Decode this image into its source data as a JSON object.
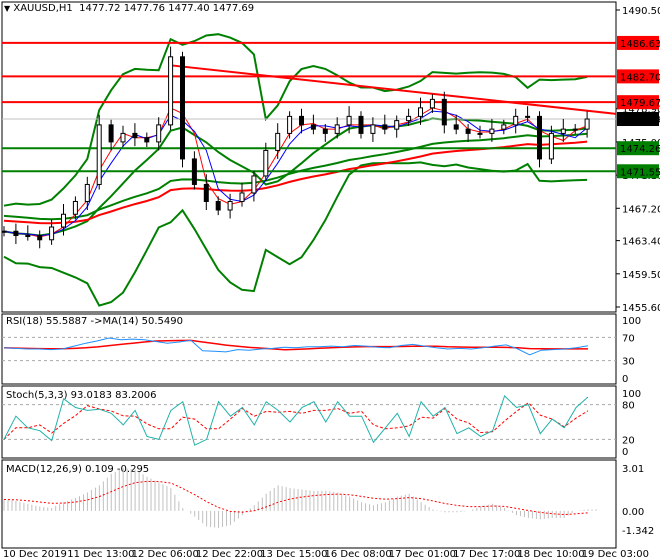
{
  "header": {
    "symbol": "XAUUSD,H1",
    "ohlc": "1477.72 1477.76 1477.40 1477.69"
  },
  "colors": {
    "up": "#000000",
    "level_red": "#ff0000",
    "level_green": "#008000",
    "bb": "#008000",
    "rsi": "#1e90ff",
    "stoch": "#20b2aa",
    "signal": "#ff0000",
    "hist": "#c0c0c0"
  },
  "chart_data": [
    {
      "type": "candlestick",
      "title": "XAUUSD,H1",
      "ylim": [
        1455.6,
        1490.5
      ],
      "y_ticks": [
        "1490.50",
        "1478.90",
        "1475.00",
        "1471.10",
        "1467.20",
        "1463.40",
        "1459.50",
        "1455.60"
      ],
      "y_tick_values": [
        1490.5,
        1478.9,
        1475.0,
        1471.1,
        1467.2,
        1463.4,
        1459.5,
        1455.6
      ],
      "levels": [
        {
          "label": "1486.63",
          "value": 1486.63,
          "color": "red"
        },
        {
          "label": "1482.70",
          "value": 1482.7,
          "color": "red"
        },
        {
          "label": "1479.67",
          "value": 1479.67,
          "color": "red"
        },
        {
          "label": "1474.26",
          "value": 1474.26,
          "color": "green"
        },
        {
          "label": "1471.55",
          "value": 1471.55,
          "color": "green"
        }
      ],
      "current_price": {
        "label": "1477.69",
        "value": 1477.69
      },
      "trendline": {
        "from": [
          14,
          1484.0
        ],
        "to": [
          49,
          1478.3
        ]
      },
      "close": [
        1464.5,
        1464,
        1464,
        1463.5,
        1465,
        1466.5,
        1468,
        1470,
        1477,
        1475,
        1476,
        1475.5,
        1475,
        1477,
        1485,
        1473,
        1470,
        1468,
        1467,
        1468,
        1469,
        1471,
        1474,
        1476,
        1478,
        1477,
        1476.5,
        1476,
        1477,
        1478,
        1476,
        1477,
        1476.5,
        1477.5,
        1478,
        1479,
        1480,
        1477,
        1476.5,
        1476,
        1476,
        1476.5,
        1477,
        1478,
        1478,
        1473,
        1476,
        1476.5,
        1476.5,
        1477.69
      ],
      "x_ticks": [
        "10 Dec 2019",
        "11 Dec 13:00",
        "12 Dec 06:00",
        "12 Dec 22:00",
        "13 Dec 15:00",
        "16 Dec 08:00",
        "17 Dec 01:00",
        "17 Dec 17:00",
        "18 Dec 10:00",
        "19 Dec 03:00"
      ]
    },
    {
      "type": "line",
      "title": "RSI(18) 55.5887  ->MA(14) 50.5490",
      "ylim": [
        0,
        100
      ],
      "y_ticks": [
        "100",
        "70",
        "30",
        "0"
      ],
      "y_tick_values": [
        100,
        70,
        30,
        0
      ],
      "rsi": [
        52,
        51,
        50,
        50,
        49,
        50,
        55,
        60,
        64,
        69,
        66,
        67,
        66,
        63,
        60,
        62,
        65,
        47,
        46,
        45,
        49,
        48,
        50,
        51,
        53,
        52,
        54,
        54,
        55,
        54,
        56,
        55,
        53,
        52,
        56,
        58,
        55,
        52,
        50,
        51,
        50,
        52,
        55,
        57,
        50,
        40,
        48,
        49,
        50,
        52,
        55.59
      ]
    },
    {
      "type": "line",
      "title": "Stoch(5,3,3) 93.0183 83.2006",
      "ylim": [
        0,
        100
      ],
      "y_ticks": [
        "100",
        "80",
        "20",
        "0"
      ],
      "y_tick_values": [
        100,
        80,
        20,
        0
      ],
      "main": [
        20,
        60,
        40,
        35,
        18,
        90,
        75,
        70,
        72,
        65,
        45,
        70,
        25,
        20,
        70,
        85,
        10,
        20,
        85,
        60,
        75,
        45,
        85,
        70,
        50,
        75,
        85,
        50,
        85,
        60,
        60,
        15,
        40,
        65,
        25,
        85,
        60,
        75,
        30,
        40,
        25,
        35,
        95,
        75,
        80,
        30,
        55,
        40,
        75,
        93.02
      ]
    },
    {
      "type": "histogram",
      "title": "MACD(12,26,9) 0.109 -0.295",
      "ylim": [
        -1.342,
        3.01
      ],
      "y_ticks": [
        "3.01",
        "0.00",
        "-1.342"
      ],
      "y_tick_values": [
        3.01,
        0,
        -1.342
      ],
      "hist": [
        0.8,
        0.7,
        0.5,
        0.3,
        0.2,
        0.6,
        0.9,
        1.3,
        1.8,
        2.6,
        3.0,
        2.9,
        2.4,
        2.0,
        1.6,
        0.2,
        -0.4,
        -1.1,
        -1.2,
        -1.0,
        -0.3,
        0.4,
        1.2,
        1.8,
        1.6,
        1.5,
        1.4,
        1.4,
        1.3,
        1.0,
        0.6,
        0.4,
        0.6,
        1.0,
        1.2,
        0.6,
        0.1,
        -0.1,
        -0.1,
        0.0,
        0.3,
        0.5,
        0.2,
        -0.3,
        -0.5,
        -0.6,
        -0.5,
        -0.5,
        0.0,
        0.109
      ]
    }
  ]
}
